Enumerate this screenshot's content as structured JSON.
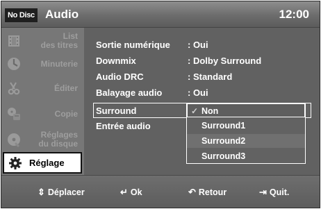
{
  "header": {
    "badge": "No Disc",
    "title": "Audio",
    "clock": "12:00"
  },
  "sidebar": {
    "items": [
      {
        "icon": "film-strip-icon",
        "label_line1": "List",
        "label_line2": "des titres"
      },
      {
        "icon": "clock-icon",
        "label_line1": "Minuterie",
        "label_line2": ""
      },
      {
        "icon": "scissors-icon",
        "label_line1": "Éditer",
        "label_line2": ""
      },
      {
        "icon": "copy-icon",
        "label_line1": "Copie",
        "label_line2": ""
      },
      {
        "icon": "disc-icon",
        "label_line1": "Réglages",
        "label_line2": "du disque"
      },
      {
        "icon": "gear-icon",
        "label_line1": "Réglage",
        "label_line2": ""
      }
    ],
    "active_index": 5
  },
  "settings": [
    {
      "label": "Sortie numérique",
      "value": ": Oui"
    },
    {
      "label": "Downmix",
      "value": ": Dolby Surround"
    },
    {
      "label": "Audio DRC",
      "value": ": Standard"
    },
    {
      "label": "Balayage audio",
      "value": ": Oui"
    },
    {
      "label": "Surround",
      "value": ""
    },
    {
      "label": "Entrée audio",
      "value": ""
    }
  ],
  "dropdown": {
    "options": [
      "Non",
      "Surround1",
      "Surround2",
      "Surround3"
    ],
    "selected_index": 0,
    "check_glyph": "✓"
  },
  "footer": {
    "move_icon": "⇕",
    "move": "Déplacer",
    "ok_icon": "↵",
    "ok": "Ok",
    "back_icon": "↶",
    "back": "Retour",
    "quit_icon": "⇥",
    "quit": "Quit."
  },
  "colors": {
    "background": "#5a5a5a",
    "header": "#6c6c6c",
    "sidebar": "#777777",
    "text": "#ffffff",
    "inactive_text": "#9e9e9e"
  }
}
